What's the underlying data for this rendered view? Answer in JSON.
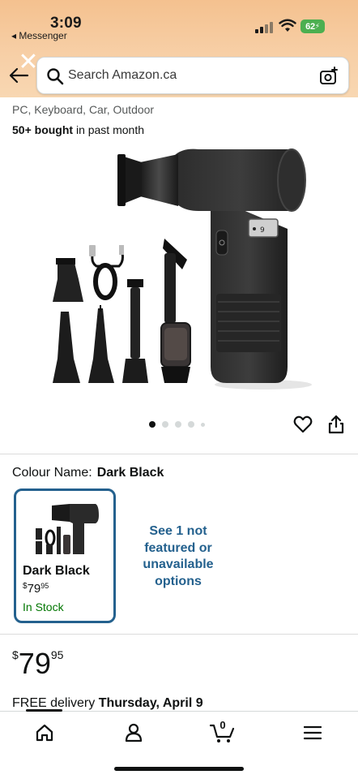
{
  "status_bar": {
    "time": "3:09",
    "back_app": "◂ Messenger",
    "battery": "62"
  },
  "search": {
    "placeholder": "Search Amazon.ca",
    "value": ""
  },
  "product": {
    "subtitle": "PC, Keyboard, Car, Outdoor",
    "bought_count": "50+ bought",
    "bought_suffix": " in past month",
    "image_count": 5,
    "active_image_index": 0,
    "image_screen_text": "9"
  },
  "colour": {
    "label": "Colour Name:",
    "selected": "Dark Black",
    "swatch": {
      "name": "Dark Black",
      "price_symbol": "$",
      "price_whole": "79",
      "price_fraction": "95",
      "stock": "In Stock"
    },
    "not_featured": "See 1 not featured or unavailable options"
  },
  "price": {
    "symbol": "$",
    "whole": "79",
    "fraction": "95"
  },
  "delivery": {
    "prefix": "FREE delivery ",
    "date": "Thursday, April 9"
  },
  "bottom_nav": {
    "cart_count": "0",
    "items": [
      "home",
      "account",
      "cart",
      "menu"
    ]
  },
  "colors": {
    "header_bg": "#f4c18f",
    "link_blue": "#24618e",
    "in_stock_green": "#007600",
    "battery_green": "#4caf50"
  },
  "icons": [
    "search-icon",
    "camera-icon",
    "back-arrow-icon",
    "close-icon",
    "heart-icon",
    "share-icon",
    "home-icon",
    "account-icon",
    "cart-icon",
    "menu-icon"
  ]
}
